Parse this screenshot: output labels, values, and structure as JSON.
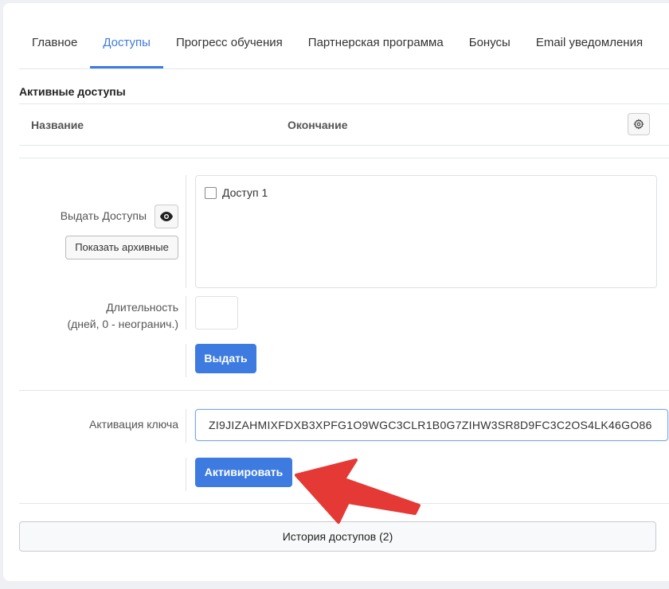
{
  "tabs": [
    {
      "label": "Главное",
      "active": false
    },
    {
      "label": "Доступы",
      "active": true
    },
    {
      "label": "Прогресс обучения",
      "active": false
    },
    {
      "label": "Партнерская программа",
      "active": false
    },
    {
      "label": "Бонусы",
      "active": false
    },
    {
      "label": "Email уведомления",
      "active": false
    }
  ],
  "active_access": {
    "title": "Активные доступы",
    "columns": [
      "Название",
      "Окончание"
    ]
  },
  "grant": {
    "label": "Выдать Доступы",
    "show_archived_label": "Показать архивные",
    "options": [
      {
        "label": "Доступ 1",
        "checked": false
      }
    ],
    "duration_label_line1": "Длительность",
    "duration_label_line2": "(дней, 0 - неогранич.)",
    "duration_value": "",
    "submit_label": "Выдать"
  },
  "key_activation": {
    "label": "Активация ключа",
    "value": "ZI9JIZAHMIXFDXB3XPFG1O9WGC3CLR1B0G7ZIHW3SR8D9FC3C2OS4LK46GO86",
    "submit_label": "Активировать"
  },
  "history": {
    "label": "История доступов (2)"
  },
  "colors": {
    "accent": "#3d7be0",
    "annotation_arrow": "#e53935"
  }
}
